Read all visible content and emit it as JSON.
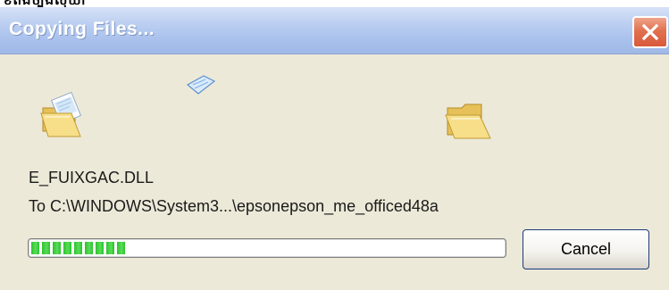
{
  "window": {
    "title": "Copying Files...",
    "close_glyph": "✕"
  },
  "operation": {
    "file_name": "E_FUIXGAC.DLL",
    "destination": "To C:\\WINDOWS\\System3...\\epsonepson_me_officed48a"
  },
  "progress": {
    "fraction": 0.21
  },
  "buttons": {
    "cancel_label": "Cancel"
  },
  "icons": {
    "source": "folder-open-with-document-icon",
    "flying": "flying-document-icon",
    "destination": "folder-open-icon",
    "close": "close-icon"
  },
  "colors": {
    "titlebar_start": "#d6e2f7",
    "titlebar_end": "#9fb8e6",
    "window_bg": "#ece9d8",
    "close_button": "#e1714f",
    "progress_green": "#2fc12f",
    "button_border": "#1c3a7a"
  }
}
